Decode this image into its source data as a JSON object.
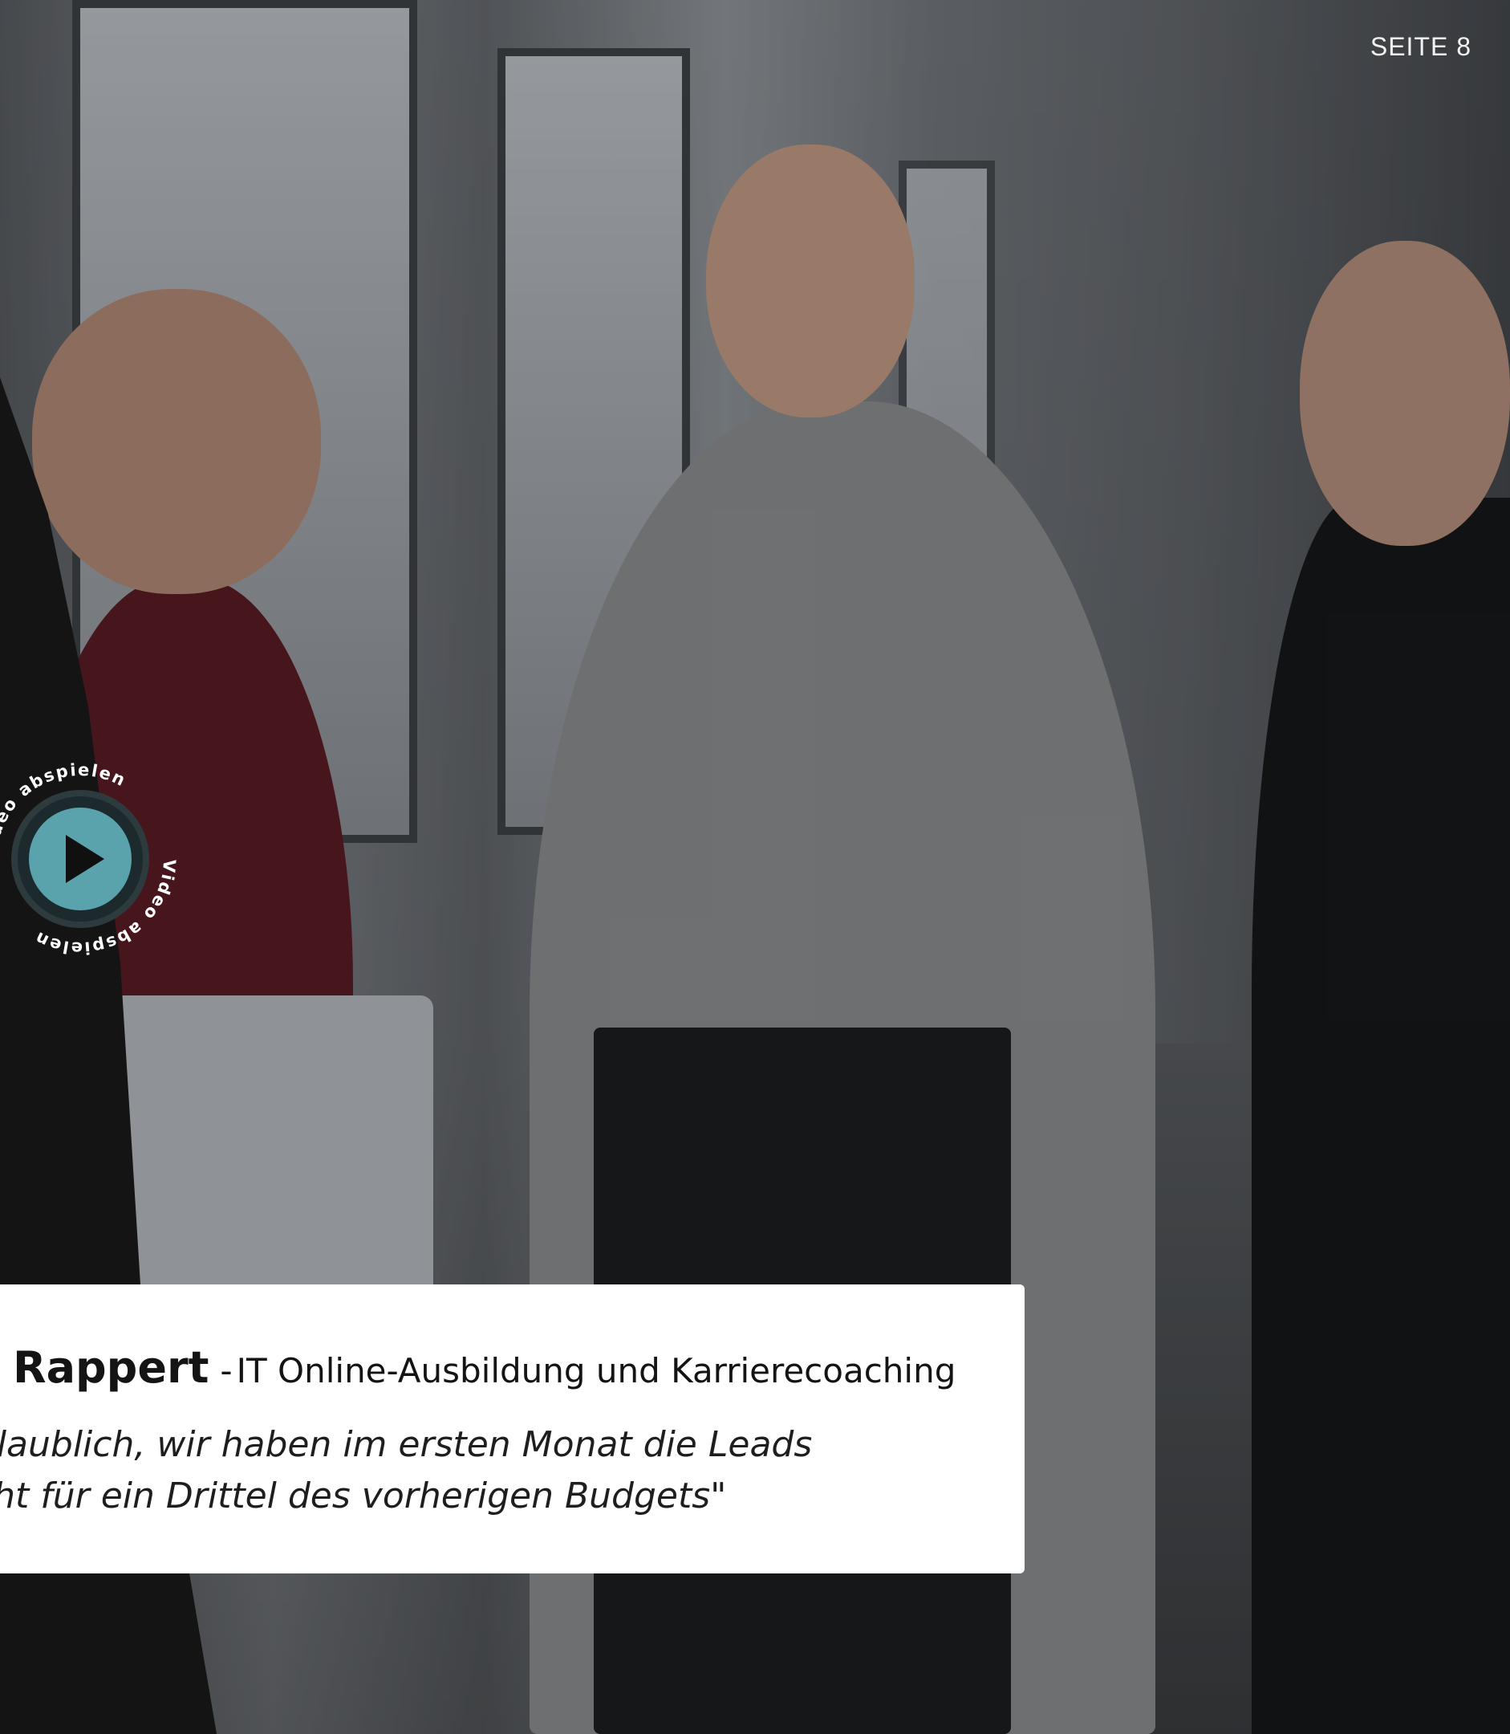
{
  "page": {
    "label": "SEITE 8"
  },
  "video": {
    "ring_text": "Video abspielen",
    "play_color": "#5aa3ad"
  },
  "testimonial": {
    "name": "Rappert",
    "separator": "-",
    "company": "IT Online-Ausbildung und Karrierecoaching",
    "quote_line1": "nglaublich, wir haben im ersten Monat die Leads",
    "quote_line2": "acht für ein Drittel des vorherigen Budgets\""
  },
  "colors": {
    "dark_panel": "#141414",
    "card_bg": "#ffffff",
    "text_dark": "#141414"
  }
}
